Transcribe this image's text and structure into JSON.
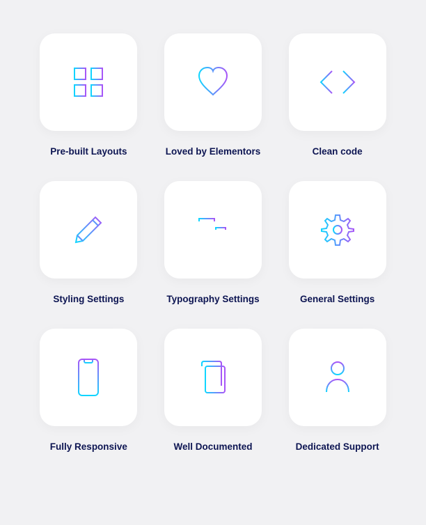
{
  "features": [
    {
      "id": "grid-icon",
      "label": "Pre-built Layouts"
    },
    {
      "id": "heart-icon",
      "label": "Loved by Elementors"
    },
    {
      "id": "code-icon",
      "label": "Clean code"
    },
    {
      "id": "pencil-icon",
      "label": "Styling Settings"
    },
    {
      "id": "typography-icon",
      "label": "Typography Settings"
    },
    {
      "id": "gear-icon",
      "label": "General Settings"
    },
    {
      "id": "phone-icon",
      "label": "Fully Responsive"
    },
    {
      "id": "document-icon",
      "label": "Well Documented"
    },
    {
      "id": "user-icon",
      "label": "Dedicated Support"
    }
  ],
  "colors": {
    "gradient_start": "#0fd6ff",
    "gradient_end": "#a855f7"
  }
}
